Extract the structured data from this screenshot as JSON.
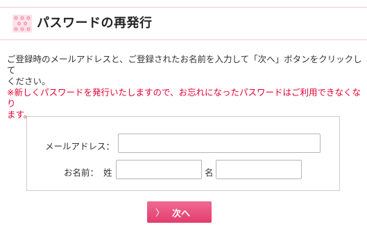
{
  "header": {
    "title": "パスワードの再発行",
    "icon": "pink-pattern-icon"
  },
  "intro": {
    "line1": "ご登録時のメールアドレスと、ご登録されたお名前を入力して「次へ」ボタンをクリックして",
    "line2": "ください。",
    "warning_line1": "※新しくパスワードを発行いたしますので、お忘れになったパスワードはご利用できなくなり",
    "warning_line2": "ます。"
  },
  "form": {
    "email_label": "メールアドレス：",
    "email_value": "",
    "name_label": "お名前：",
    "last_name_label": "姓",
    "last_name_value": "",
    "first_name_label": "名",
    "first_name_value": ""
  },
  "submit": {
    "chevron": "〉",
    "label": "次へ"
  },
  "colors": {
    "accent": "#e23d6e",
    "warning": "#e60033",
    "header_border": "#f3c9d4"
  }
}
